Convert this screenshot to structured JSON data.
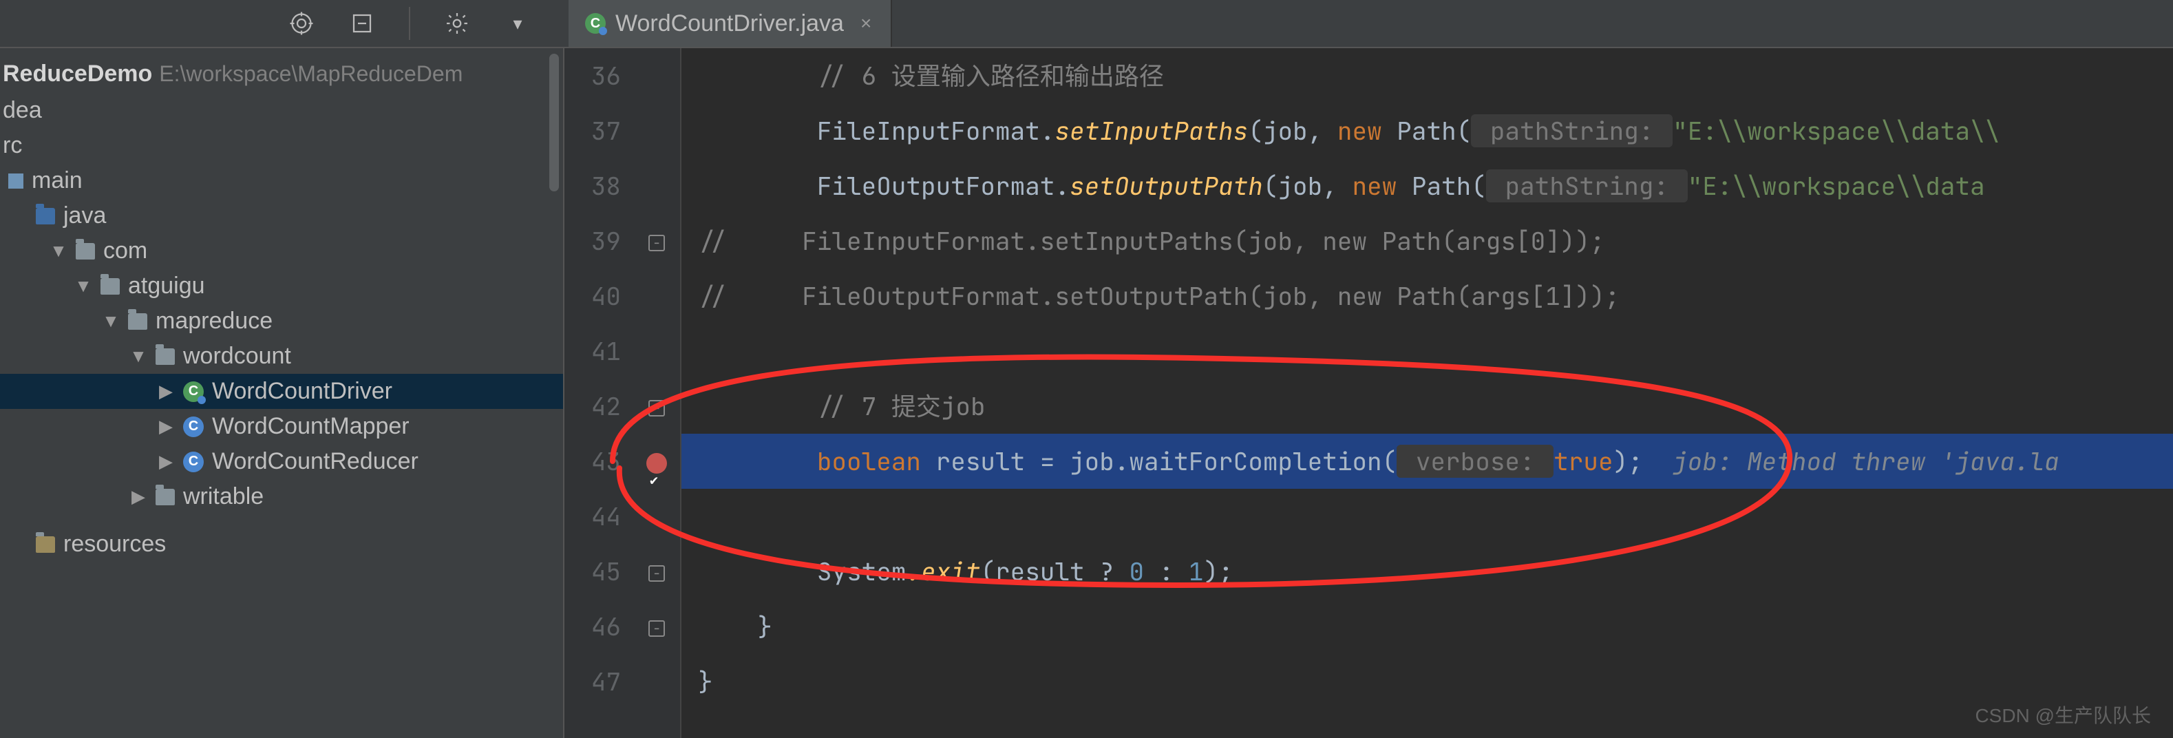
{
  "toolbar": {
    "target_icon": "target-icon",
    "refresh_icon": "refresh-icon",
    "gear_icon": "gear-icon"
  },
  "tab": {
    "file_name": "WordCountDriver.java",
    "close_glyph": "×"
  },
  "project": {
    "name": "ReduceDemo",
    "path": "E:\\workspace\\MapReduceDem",
    "nodes": {
      "dea": "dea",
      "rc": "rc",
      "main": "main",
      "java": "java",
      "com": "com",
      "atguigu": "atguigu",
      "mapreduce": "mapreduce",
      "wordcount": "wordcount",
      "driver": "WordCountDriver",
      "mapper": "WordCountMapper",
      "reducer": "WordCountReducer",
      "writable": "writable",
      "resources": "resources"
    }
  },
  "editor": {
    "lines": {
      "36": {
        "num": "36",
        "comment": "// 6 设置输入路径和输出路径"
      },
      "37": {
        "num": "37",
        "cls": "FileInputFormat",
        "dot": ".",
        "method": "setInputPaths",
        "open": "(job, ",
        "kw_new": "new",
        "path": " Path(",
        "hint": " pathString: ",
        "str": "\"E:\\\\workspace\\\\data\\\\",
        "tail": ""
      },
      "38": {
        "num": "38",
        "cls": "FileOutputFormat",
        "dot": ".",
        "method": "setOutputPath",
        "open": "(job, ",
        "kw_new": "new",
        "path": " Path(",
        "hint": " pathString: ",
        "str": "\"E:\\\\workspace\\\\data",
        "tail": ""
      },
      "39": {
        "num": "39",
        "text": "//     FileInputFormat.setInputPaths(job, new Path(args[0]));"
      },
      "40": {
        "num": "40",
        "text": "//     FileOutputFormat.setOutputPath(job, new Path(args[1]));"
      },
      "41": {
        "num": "41"
      },
      "42": {
        "num": "42",
        "comment": "// 7 提交job"
      },
      "43": {
        "num": "43",
        "kw_bool": "boolean",
        "mid": " result = job.waitForCompletion(",
        "hint": " verbose: ",
        "kw_true": "true",
        "close": ");",
        "inline": "  job: Method threw 'java.la"
      },
      "44": {
        "num": "44"
      },
      "45": {
        "num": "45",
        "sys": "System",
        "exit": ".exit",
        "open": "(result ? ",
        "n0": "0",
        "colon": " : ",
        "n1": "1",
        "close": ");"
      },
      "46": {
        "num": "46",
        "brace": "}"
      },
      "47": {
        "num": "47",
        "brace": "}"
      }
    }
  },
  "watermark": "CSDN @生产队队长"
}
